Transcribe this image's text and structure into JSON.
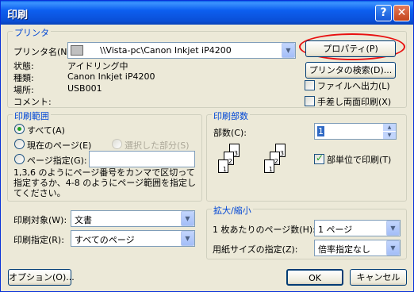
{
  "window": {
    "title": "印刷"
  },
  "printer_group": {
    "legend": "プリンタ",
    "name_label": "プリンタ名(N):",
    "name_value": "\\\\Vista-pc\\Canon Inkjet iP4200",
    "status_label": "状態:",
    "status_value": "アイドリング中",
    "type_label": "種類:",
    "type_value": "Canon Inkjet iP4200",
    "where_label": "場所:",
    "where_value": "USB001",
    "comment_label": "コメント:",
    "properties_button": "プロパティ(P)",
    "find_printer_button": "プリンタの検索(D)...",
    "print_to_file": "ファイルへ出力(L)",
    "manual_duplex": "手差し両面印刷(X)",
    "highlight_color": "#e81010"
  },
  "range_group": {
    "legend": "印刷範囲",
    "all": "すべて(A)",
    "current_page": "現在のページ(E)",
    "selection": "選択した部分(S)",
    "pages": "ページ指定(G):",
    "hint": "1,3,6 のようにページ番号をカンマで区切って指定するか、4-8 のようにページ範囲を指定してください。"
  },
  "copies_group": {
    "legend": "印刷部数",
    "copies_label": "部数(C):",
    "copies_value": "1",
    "collate": "部単位で印刷(T)",
    "stack_a": [
      "1",
      "2",
      "3"
    ],
    "stack_b": [
      "1",
      "2",
      "3"
    ]
  },
  "print_what": {
    "label": "印刷対象(W):",
    "value": "文書"
  },
  "print_select": {
    "label": "印刷指定(R):",
    "value": "すべてのページ"
  },
  "zoom_group": {
    "legend": "拡大/縮小",
    "pages_per_sheet_label": "1 枚あたりのページ数(H):",
    "pages_per_sheet_value": "1 ページ",
    "scale_label": "用紙サイズの指定(Z):",
    "scale_value": "倍率指定なし"
  },
  "footer": {
    "options_button": "オプション(O)...",
    "ok_button": "OK",
    "cancel_button": "キャンセル"
  }
}
